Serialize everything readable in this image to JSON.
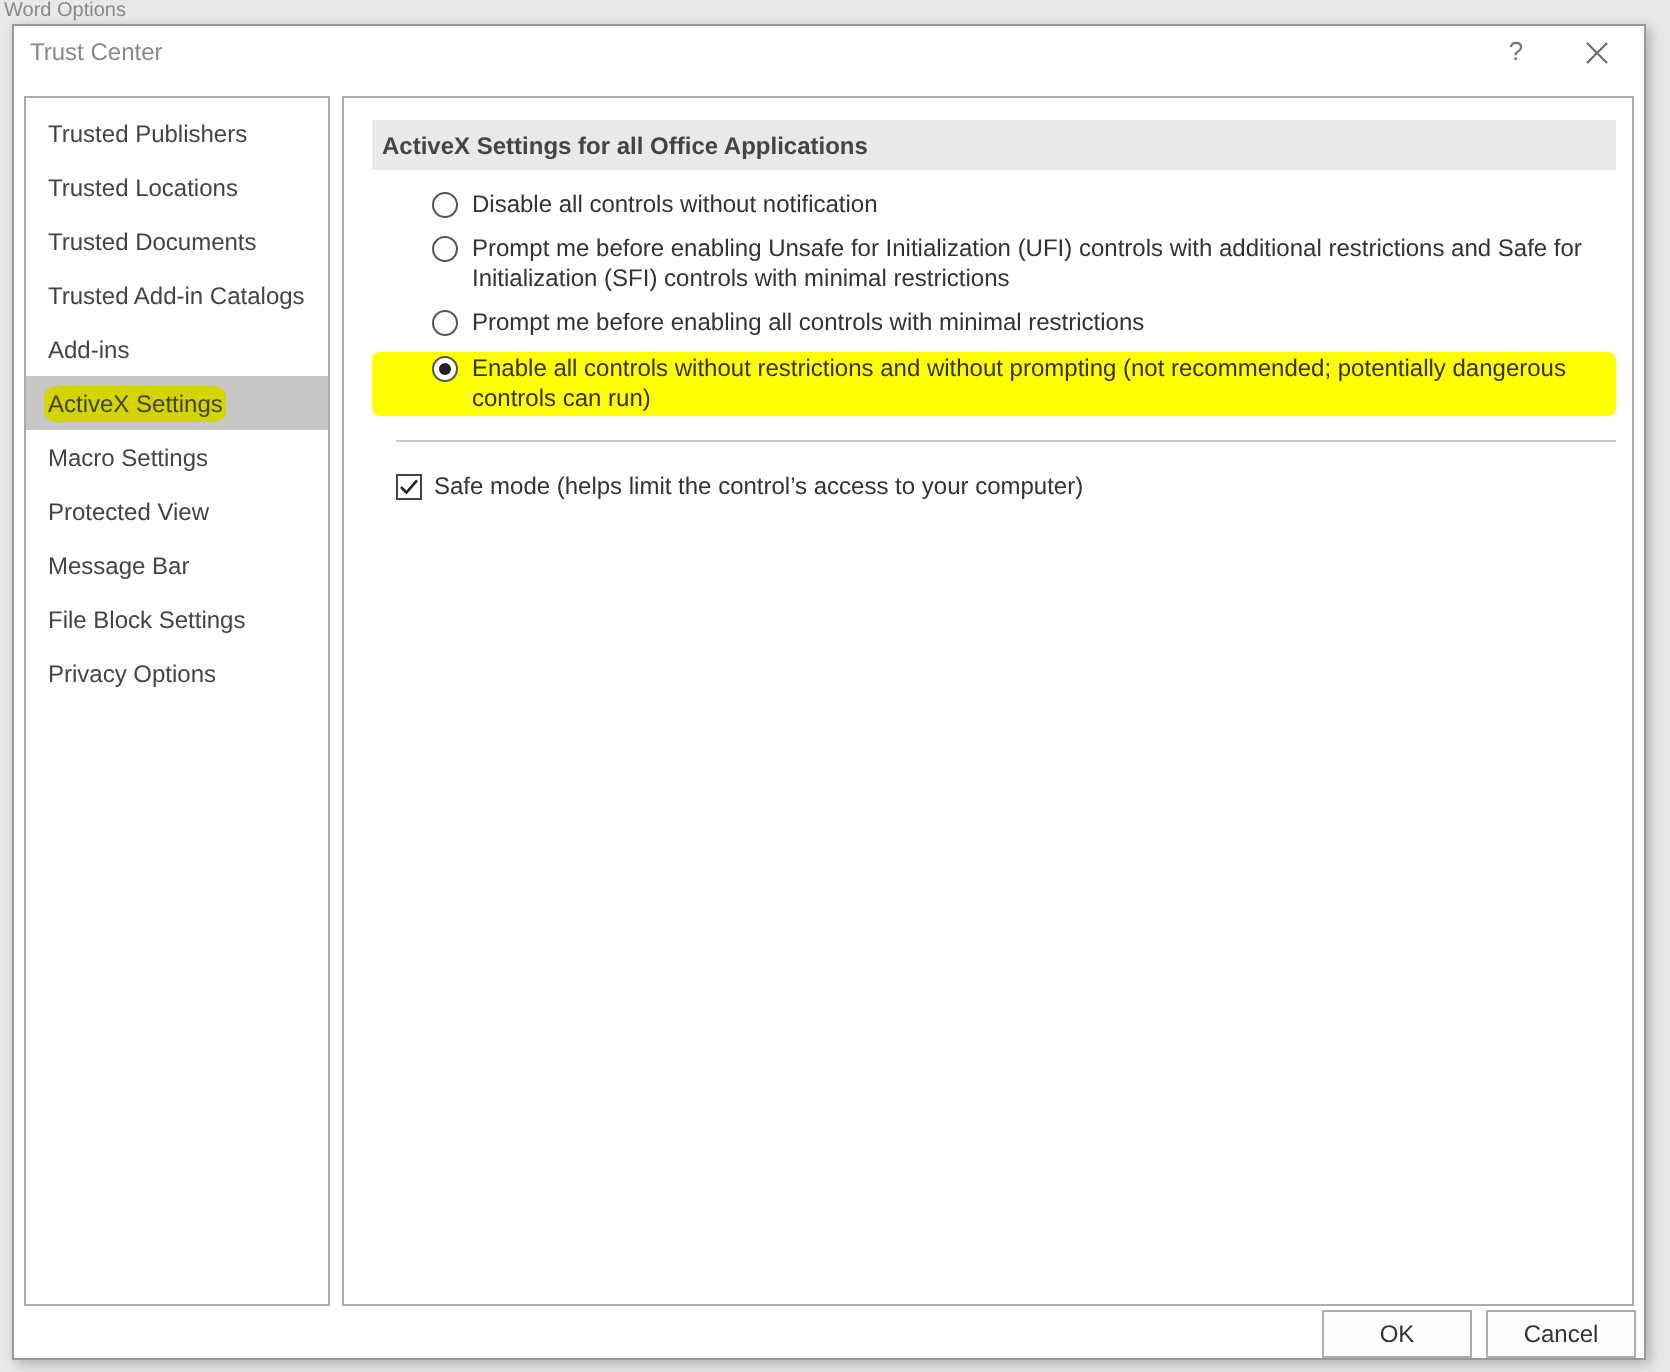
{
  "background_window": {
    "title": "Word Options"
  },
  "window": {
    "title": "Trust Center",
    "help": "?"
  },
  "sidebar": {
    "items": [
      {
        "label": "Trusted Publishers",
        "selected": false,
        "highlighted": false
      },
      {
        "label": "Trusted Locations",
        "selected": false,
        "highlighted": false
      },
      {
        "label": "Trusted Documents",
        "selected": false,
        "highlighted": false
      },
      {
        "label": "Trusted Add-in Catalogs",
        "selected": false,
        "highlighted": false
      },
      {
        "label": "Add-ins",
        "selected": false,
        "highlighted": false
      },
      {
        "label": "ActiveX Settings",
        "selected": true,
        "highlighted": true
      },
      {
        "label": "Macro Settings",
        "selected": false,
        "highlighted": false
      },
      {
        "label": "Protected View",
        "selected": false,
        "highlighted": false
      },
      {
        "label": "Message Bar",
        "selected": false,
        "highlighted": false
      },
      {
        "label": "File Block Settings",
        "selected": false,
        "highlighted": false
      },
      {
        "label": "Privacy Options",
        "selected": false,
        "highlighted": false
      }
    ]
  },
  "section": {
    "title": "ActiveX Settings for all Office Applications",
    "options": [
      {
        "label": "Disable all controls without notification",
        "selected": false,
        "highlighted": false
      },
      {
        "label": "Prompt me before enabling Unsafe for Initialization (UFI) controls with additional restrictions and Safe for Initialization (SFI) controls with minimal restrictions",
        "selected": false,
        "highlighted": false
      },
      {
        "label": "Prompt me before enabling all controls with minimal restrictions",
        "selected": false,
        "highlighted": false
      },
      {
        "label": "Enable all controls without restrictions and without prompting (not recommended; potentially dangerous controls can run)",
        "selected": true,
        "highlighted": true
      }
    ],
    "safe_mode": {
      "label": "Safe mode (helps limit the control’s access to your computer)",
      "checked": true
    }
  },
  "buttons": [
    "OK",
    "Cancel"
  ]
}
